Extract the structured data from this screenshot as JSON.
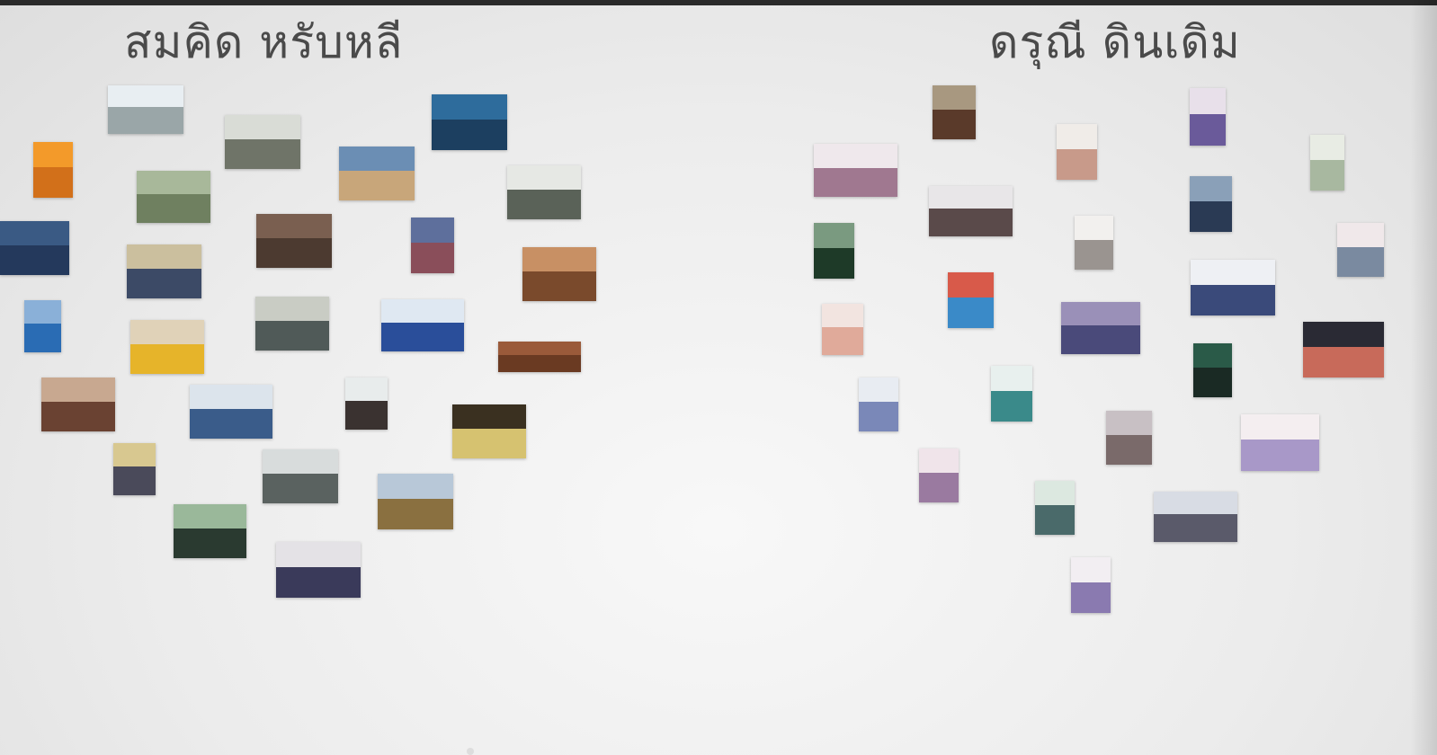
{
  "people": {
    "left_name": "สมคิด หรับหลี",
    "right_name": "ดรุณี ดินเดิม"
  },
  "colors": {
    "background": "#ececec",
    "title_text": "#4a4a4a"
  }
}
